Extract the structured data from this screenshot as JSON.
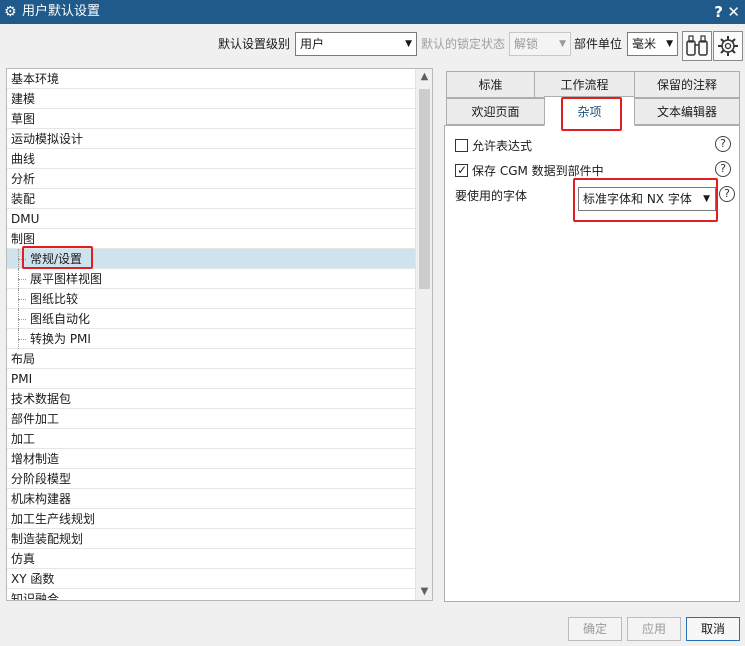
{
  "window": {
    "title": "用户默认设置",
    "help": "?",
    "close": "✕"
  },
  "toolbar": {
    "level_label": "默认设置级别",
    "level_value": "用户",
    "lock_label": "默认的锁定状态",
    "lock_value": "解锁",
    "unit_label": "部件单位",
    "unit_value": "毫米"
  },
  "tree": {
    "items": [
      "基本环境",
      "建模",
      "草图",
      "运动模拟设计",
      "曲线",
      "分析",
      "装配",
      "DMU",
      "制图",
      "常规/设置",
      "展平图样视图",
      "图纸比较",
      "图纸自动化",
      "转换为 PMI",
      "布局",
      "PMI",
      "技术数据包",
      "部件加工",
      "加工",
      "增材制造",
      "分阶段模型",
      "机床构建器",
      "加工生产线规划",
      "制造装配规划",
      "仿真",
      "XY 函数",
      "知识融合"
    ]
  },
  "tabs": {
    "row1": [
      "标准",
      "工作流程",
      "保留的注释"
    ],
    "row2": [
      "欢迎页面",
      "杂项",
      "文本编辑器"
    ]
  },
  "panel": {
    "allow_expressions": "允许表达式",
    "save_cgm": "保存 CGM 数据到部件中",
    "font_label": "要使用的字体",
    "font_value": "标准字体和 NX 字体",
    "help": "?"
  },
  "buttons": {
    "ok": "确定",
    "apply": "应用",
    "cancel": "取消"
  },
  "colors": {
    "titlebar": "#1f5a8a",
    "highlight_box": "#e02020",
    "selected_row": "#cfe3ee"
  }
}
